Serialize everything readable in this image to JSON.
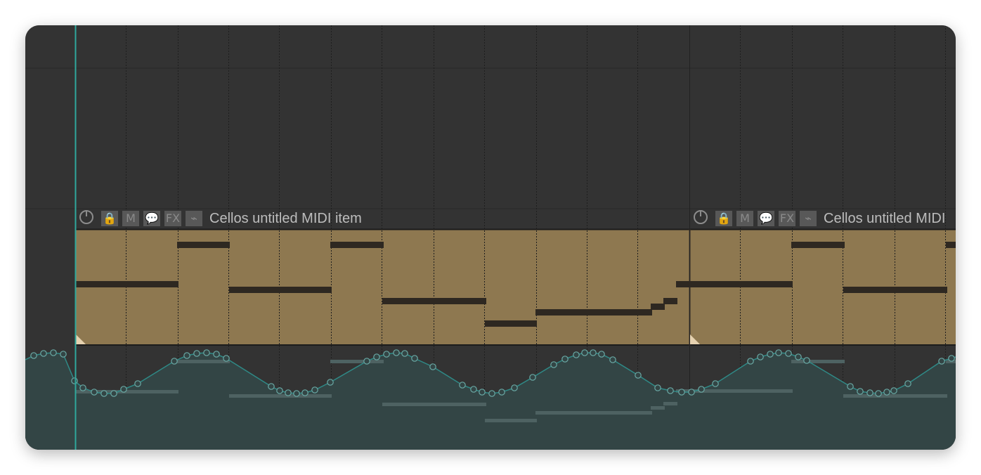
{
  "track": {
    "items": [
      {
        "title": "Cellos untitled MIDI item"
      },
      {
        "title": "Cellos untitled MIDI"
      }
    ],
    "item_buttons": [
      {
        "name": "power-icon"
      },
      {
        "name": "lock-icon",
        "glyph": "🔒"
      },
      {
        "name": "mute-icon",
        "glyph": "M"
      },
      {
        "name": "notes-icon",
        "glyph": "💬"
      },
      {
        "name": "fx-icon",
        "glyph": "FX"
      },
      {
        "name": "envelope-icon",
        "glyph": "⌁"
      }
    ]
  },
  "colors": {
    "background": "#333333",
    "midi_item": "#8e7850",
    "midi_note": "#2e2821",
    "envelope": "#2f8a87",
    "envelope_fill": "#334545",
    "playhead": "#2fa89c"
  }
}
